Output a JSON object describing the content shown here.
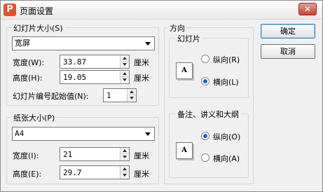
{
  "dialog": {
    "title": "页面设置",
    "close": "✕",
    "app_icon": "P"
  },
  "slide_size": {
    "legend": "幻灯片大小(S)",
    "preset": "宽屏",
    "width_label": "宽度(W):",
    "width_value": "33.87",
    "height_label": "高度(H):",
    "height_value": "19.05",
    "unit": "厘米",
    "start_number_label": "幻灯片编号起始值(N):",
    "start_number_value": "1"
  },
  "paper_size": {
    "legend": "纸张大小(P)",
    "preset": "A4",
    "width_label": "宽度(I):",
    "width_value": "21",
    "height_label": "高度(E):",
    "height_value": "29.7",
    "unit": "厘米"
  },
  "orientation": {
    "legend": "方向",
    "slides": {
      "heading": "幻灯片",
      "portrait": "纵向(R)",
      "landscape": "横向(L)",
      "selected": "landscape"
    },
    "notes": {
      "heading": "备注、讲义和大纲",
      "portrait": "纵向(O)",
      "landscape": "横向(A)",
      "selected": "portrait"
    }
  },
  "buttons": {
    "ok": "确定",
    "cancel": "取消"
  },
  "icons": {
    "page_letter": "A"
  }
}
